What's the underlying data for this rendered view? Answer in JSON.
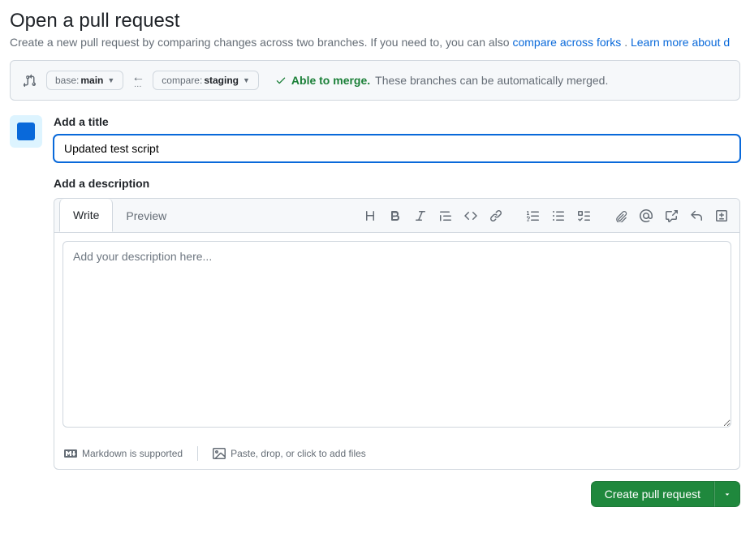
{
  "header": {
    "title": "Open a pull request",
    "subtitle_prefix": "Create a new pull request by comparing changes across two branches. If you need to, you can also ",
    "compare_forks_link": "compare across forks",
    "subtitle_mid": ". ",
    "learn_more_link": "Learn more about d"
  },
  "compare": {
    "base_label": "base: ",
    "base_branch": "main",
    "compare_label": "compare: ",
    "compare_branch": "staging",
    "merge_status": "Able to merge.",
    "merge_text": "These branches can be automatically merged."
  },
  "form": {
    "title_label": "Add a title",
    "title_value": "Updated test script",
    "desc_label": "Add a description",
    "desc_placeholder": "Add your description here..."
  },
  "editor": {
    "tabs": {
      "write": "Write",
      "preview": "Preview"
    },
    "footer": {
      "markdown": "Markdown is supported",
      "attach": "Paste, drop, or click to add files"
    }
  },
  "actions": {
    "create_label": "Create pull request"
  }
}
